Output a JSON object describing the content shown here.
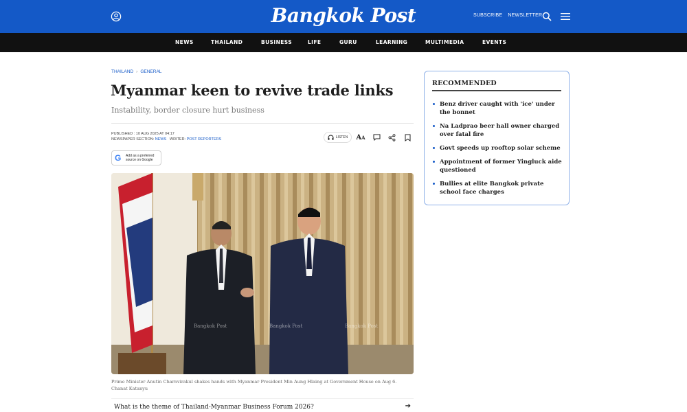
{
  "header": {
    "logo": "Bangkok Post",
    "links": [
      "SUBSCRIBE",
      "NEWSLETTER"
    ]
  },
  "nav": [
    "NEWS",
    "THAILAND",
    "BUSINESS",
    "LIFE",
    "GURU",
    "LEARNING",
    "MULTIMEDIA",
    "EVENTS"
  ],
  "article": {
    "breadcrumb": [
      "THAILAND",
      "GENERAL"
    ],
    "headline": "Myanmar keen to revive trade links",
    "subhead": "Instability, border closure hurt business",
    "published_label": "PUBLISHED : ",
    "published": "10 AUG 2025 AT 04:17",
    "section_label": "NEWSPAPER SECTION: ",
    "section": "NEWS",
    "writer_label": "WRITER: ",
    "writer": "POST REPORTERS",
    "listen_label": "LISTEN",
    "google_line1": "Add as a preferred",
    "google_line2": "source on Google",
    "photo_watermark": "Bangkok Post",
    "caption": "Prime Minister Anutin Charnvirakul shakes hands with Myanmar President Min Aung Hlaing at Government House on Aug 6.",
    "credit": "Chanat Katanyu",
    "question": "What is the theme of Thailand-Myanmar Business Forum 2026?"
  },
  "sidebar": {
    "title": "RECOMMENDED",
    "items": [
      "Benz driver caught with 'ice' under the bonnet",
      "Na Ladprao beer hall owner charged over fatal fire",
      "Govt speeds up rooftop solar scheme",
      "Appointment of former Yingluck aide questioned",
      "Bullies at elite Bangkok private school face charges"
    ]
  },
  "colors": {
    "brand_blue": "#1459c7",
    "nav_bg": "#111111",
    "sidebar_border": "#8fb1e8"
  }
}
